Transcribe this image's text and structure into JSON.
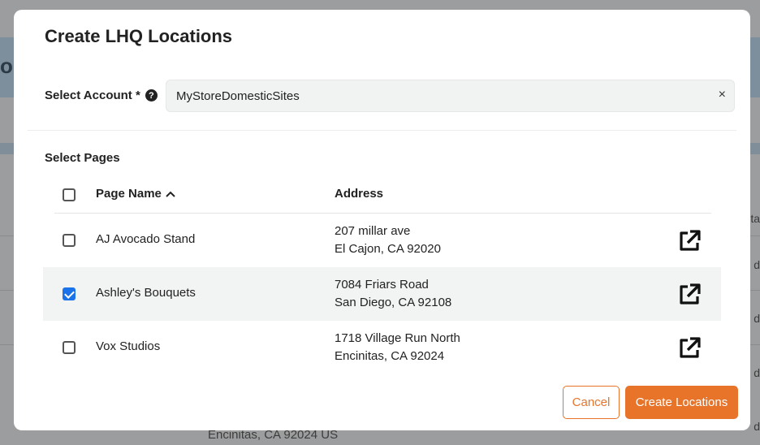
{
  "background": {
    "partial_heading": "ou",
    "partial_column": "Sta",
    "row_fragments": [
      "d",
      "d",
      "d",
      "d"
    ],
    "bottom_address": "Encinitas, CA 92024 US"
  },
  "modal": {
    "title": "Create LHQ Locations",
    "account": {
      "label": "Select Account *",
      "help_glyph": "?",
      "value": "MyStoreDomesticSites",
      "clear_glyph": "×"
    },
    "pages": {
      "label": "Select Pages",
      "columns": {
        "name": "Page Name",
        "address": "Address"
      },
      "rows": [
        {
          "name": "AJ Avocado Stand",
          "address_line1": "207 millar ave",
          "address_line2": "El Cajon, CA 92020",
          "checked": false
        },
        {
          "name": "Ashley's Bouquets",
          "address_line1": "7084 Friars Road",
          "address_line2": "San Diego, CA 92108",
          "checked": true
        },
        {
          "name": "Vox Studios",
          "address_line1": "1718 Village Run North",
          "address_line2": "Encinitas, CA 92024",
          "checked": false
        }
      ]
    },
    "buttons": {
      "cancel": "Cancel",
      "create": "Create Locations"
    },
    "colors": {
      "accent": "#e8742a",
      "checkbox": "#1a73e8"
    }
  }
}
